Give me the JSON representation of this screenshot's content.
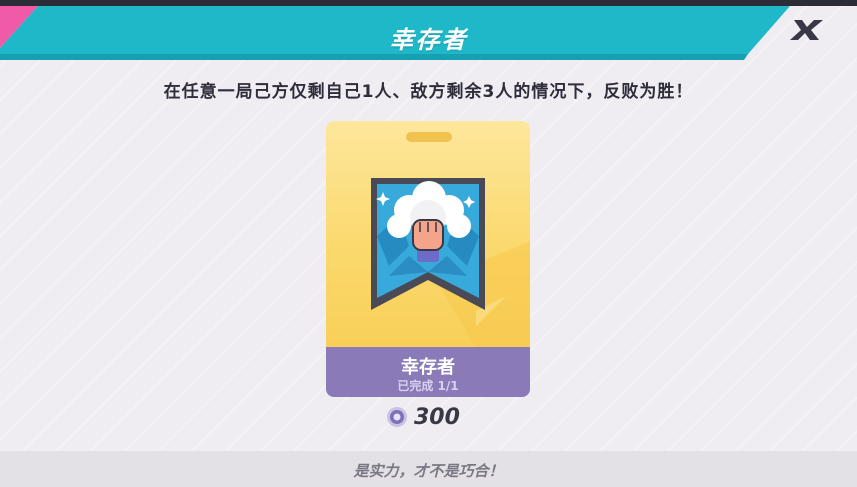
{
  "header": {
    "title": "幸存者",
    "accent_color": "#1fb8c9",
    "pink_color": "#f15aa6"
  },
  "close_button": {
    "icon": "x-close-icon",
    "label": "X"
  },
  "description": "在任意一局己方仅剩自己1人、敌方剩余3人的情况下，反败为胜！",
  "card": {
    "name": "幸存者",
    "progress": "已完成 1/1",
    "emblem_icon": "raised-fist-banner-icon"
  },
  "reward": {
    "icon": "purple-coin-icon",
    "amount": "300"
  },
  "footer": {
    "flavor_text": "是实力，才不是巧合！"
  }
}
